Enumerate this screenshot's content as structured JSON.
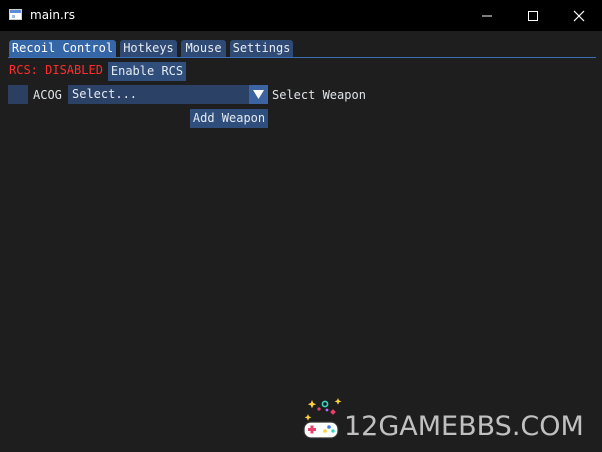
{
  "window": {
    "title": "main.rs"
  },
  "tabs": [
    {
      "label": "Recoil Control",
      "active": true
    },
    {
      "label": "Hotkeys",
      "active": false
    },
    {
      "label": "Mouse",
      "active": false
    },
    {
      "label": "Settings",
      "active": false
    }
  ],
  "recoil": {
    "status_text": "RCS: DISABLED",
    "status_color": "#ff2d2d",
    "enable_label": "Enable RCS",
    "attachment_label": "ACOG",
    "weapon_combo": {
      "value": "Select..."
    },
    "select_weapon_label": "Select Weapon",
    "add_weapon_label": "Add Weapon"
  },
  "watermark": {
    "text": "12GAMEBBS.COM"
  },
  "colors": {
    "accent": "#3566a8",
    "button": "#2f4e7c",
    "background": "#1e1e1e"
  },
  "icons": [
    "app-icon",
    "minimize-icon",
    "maximize-icon",
    "close-icon",
    "dropdown-arrow-icon",
    "gamepad-logo-icon"
  ]
}
